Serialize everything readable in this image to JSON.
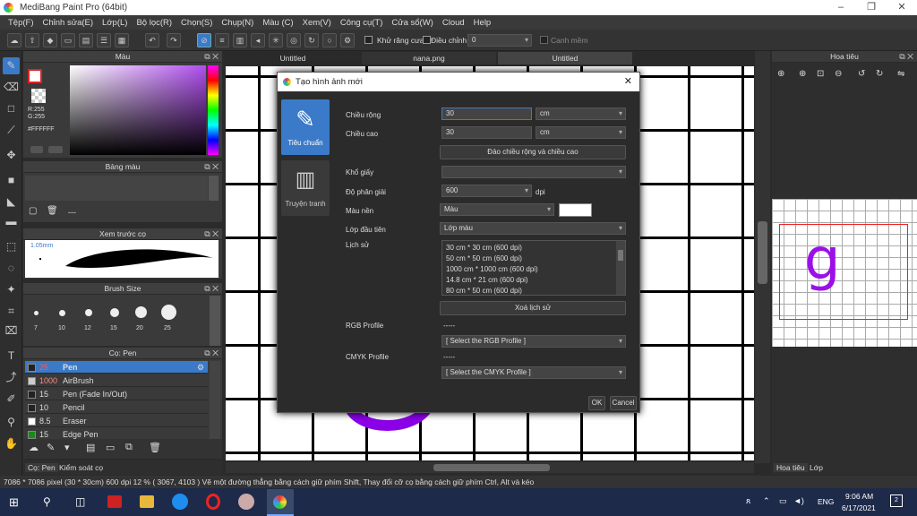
{
  "window": {
    "title": "MediBang Paint Pro (64bit)"
  },
  "menu": [
    "Tệp(F)",
    "Chỉnh sửa(E)",
    "Lớp(L)",
    "Bộ lọc(R)",
    "Chọn(S)",
    "Chụp(N)",
    "Màu (C)",
    "Xem(V)",
    "Công cụ(T)",
    "Cửa sổ(W)",
    "Cloud",
    "Help"
  ],
  "toolbar": {
    "antialias": "Khử răng cưa",
    "adjust_label": "Điều chỉnh",
    "adjust_value": "0",
    "smooth": "Canh mềm"
  },
  "color_panel": {
    "title": "Màu",
    "r": "R:255",
    "g": "G:255",
    "b": "B:255",
    "hex": "#FFFFFF"
  },
  "palette_panel": {
    "title": "Bảng màu",
    "value": "---"
  },
  "preview_panel": {
    "title": "Xem trước cọ",
    "size": "1.05mm"
  },
  "brushsize_panel": {
    "title": "Brush Size",
    "labels": [
      "7",
      "10",
      "12",
      "15",
      "20",
      "25"
    ]
  },
  "brush_panel": {
    "title": "Cọ: Pen",
    "items": [
      {
        "size": "25",
        "name": "Pen",
        "color": "#222222"
      },
      {
        "size": "1000",
        "name": "AirBrush",
        "color": "#cccccc"
      },
      {
        "size": "15",
        "name": "Pen (Fade In/Out)",
        "color": "#222222"
      },
      {
        "size": "10",
        "name": "Pencil",
        "color": "#222222"
      },
      {
        "size": "8.5",
        "name": "Eraser",
        "color": "#ffffff"
      },
      {
        "size": "15",
        "name": "Edge Pen",
        "color": "#1a8a1a"
      }
    ]
  },
  "bottom_tabs": {
    "left1": "Cọ: Pen",
    "left2": "Kiểm soát cọ",
    "right1": "Hoa tiêu",
    "right2": "Lớp"
  },
  "canvas_tabs": [
    "Untitled",
    "nana.png",
    "Untitled"
  ],
  "navigator": {
    "title": "Hoa tiêu",
    "glyph": "g"
  },
  "status": "7086 * 7086 pixel   (30 * 30cm)   600 dpi   12 %   ( 3067, 4103 )   Vẽ một đường thẳng bằng cách giữ phím Shift, Thay đổi cỡ cọ bằng cách giữ phím Ctrl, Alt và kéo",
  "taskbar": {
    "time": "9:06 AM",
    "date": "6/17/2021",
    "lang": "ENG",
    "notif": "2"
  },
  "dialog": {
    "title": "Tạo hình ảnh mới",
    "side_standard": "Tiêu chuẩn",
    "side_comic": "Truyện tranh",
    "width_label": "Chiều rộng",
    "width_value": "30",
    "width_unit": "cm",
    "height_label": "Chiều cao",
    "height_value": "30",
    "height_unit": "cm",
    "swap_button": "Đảo chiều rộng và chiều cao",
    "paper_label": "Khổ giấy",
    "paper_value": "",
    "dpi_label": "Độ phân giải",
    "dpi_value": "600",
    "dpi_unit": "dpi",
    "bg_label": "Màu nền",
    "bg_value": "Màu",
    "first_layer_label": "Lớp đầu tiên",
    "first_layer_value": "Lớp màu",
    "history_label": "Lịch sử",
    "history": [
      "30 cm * 30 cm (600 dpi)",
      "50 cm * 50 cm (600 dpi)",
      "1000 cm * 1000 cm (600 dpi)",
      "14.8 cm * 21 cm (600 dpi)",
      "80 cm * 50 cm (600 dpi)"
    ],
    "clear_history": "Xoá lịch sử",
    "rgb_label": "RGB Profile",
    "rgb_dash": "-----",
    "rgb_value": "[ Select the RGB Profile ]",
    "cmyk_label": "CMYK Profile",
    "cmyk_dash": "-----",
    "cmyk_value": "[ Select the CMYK Profile ]",
    "ok": "OK",
    "cancel": "Cancel"
  }
}
